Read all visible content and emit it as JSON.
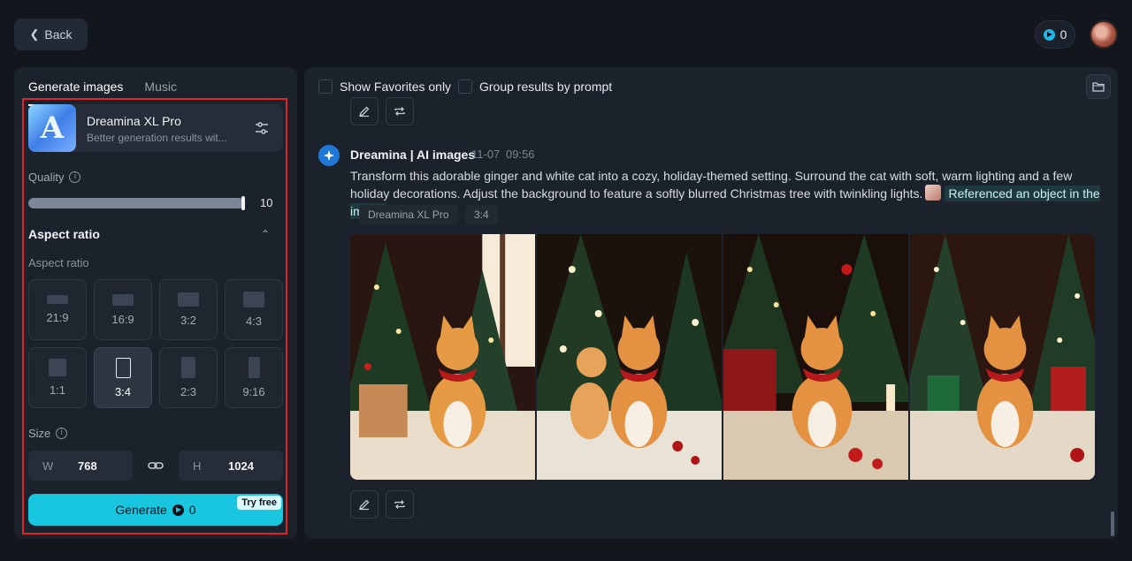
{
  "header": {
    "back_label": "Back",
    "credits": "0"
  },
  "left_panel": {
    "tabs": [
      {
        "label": "Generate images",
        "active": true
      },
      {
        "label": "Music",
        "active": false
      }
    ],
    "model": {
      "name": "Dreamina XL Pro",
      "description": "Better generation results wit...",
      "thumb_letter": "A"
    },
    "quality": {
      "label": "Quality",
      "value": "10",
      "level": 1.0
    },
    "aspect_ratio": {
      "header": "Aspect ratio",
      "sublabel": "Aspect ratio",
      "options": [
        {
          "label": "21:9",
          "selected": false
        },
        {
          "label": "16:9",
          "selected": false
        },
        {
          "label": "3:2",
          "selected": false
        },
        {
          "label": "4:3",
          "selected": false
        },
        {
          "label": "1:1",
          "selected": false
        },
        {
          "label": "3:4",
          "selected": true
        },
        {
          "label": "2:3",
          "selected": false
        },
        {
          "label": "9:16",
          "selected": false
        }
      ]
    },
    "size": {
      "label": "Size",
      "width_label": "W",
      "width_value": "768",
      "height_label": "H",
      "height_value": "1024"
    },
    "generate": {
      "label": "Generate",
      "cost": "0",
      "badge": "Try free"
    }
  },
  "right_panel": {
    "filters": {
      "favorites_label": "Show Favorites only",
      "group_label": "Group results by prompt"
    },
    "result": {
      "author": "Dreamina | AI images",
      "date": "11-07",
      "time": "09:56",
      "prompt": "Transform this adorable ginger and white cat into a cozy, holiday-themed setting. Surround the cat with soft, warm lighting and a few holiday decorations. Adjust the background to feature a softly blurred Christmas tree with twinkling lights.",
      "reference_label": "Referenced an object in the image",
      "tags": [
        "Dreamina XL Pro",
        "3:4"
      ],
      "image_count": 4
    }
  },
  "colors": {
    "accent": "#18c6e0",
    "highlight_border": "#e0222a",
    "background": "#12161d",
    "panel": "#1c222c"
  }
}
